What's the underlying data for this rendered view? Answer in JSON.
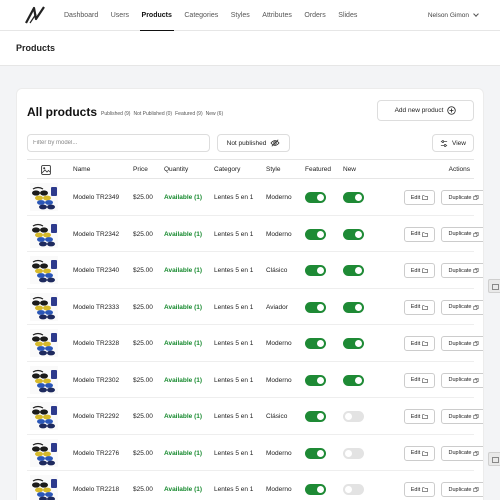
{
  "nav": {
    "items": [
      {
        "label": "Dashboard",
        "name": "nav-dashboard",
        "active": false
      },
      {
        "label": "Users",
        "name": "nav-users",
        "active": false
      },
      {
        "label": "Products",
        "name": "nav-products",
        "active": true
      },
      {
        "label": "Categories",
        "name": "nav-categories",
        "active": false
      },
      {
        "label": "Styles",
        "name": "nav-styles",
        "active": false
      },
      {
        "label": "Attributes",
        "name": "nav-attributes",
        "active": false
      },
      {
        "label": "Orders",
        "name": "nav-orders",
        "active": false
      },
      {
        "label": "Slides",
        "name": "nav-slides",
        "active": false
      }
    ],
    "user_name": "Nelson Gimon"
  },
  "page": {
    "title": "Products"
  },
  "card": {
    "title": "All products",
    "counts": [
      "Published (9)",
      "Not Published (0)",
      "Featured (9)",
      "New (6)"
    ],
    "add_label": "Add new product",
    "filter_placeholder": "Filter by model...",
    "not_published_label": "Not published",
    "view_label": "View"
  },
  "table": {
    "headers": {
      "name": "Name",
      "price": "Price",
      "quantity": "Quantity",
      "category": "Category",
      "style": "Style",
      "featured": "Featured",
      "new": "New",
      "actions": "Actions"
    },
    "edit_label": "Edit",
    "duplicate_label": "Duplicate",
    "rows": [
      {
        "name": "Modelo TR2349",
        "price": "$25.00",
        "quantity": "Available (1)",
        "category": "Lentes 5 en 1",
        "style": "Moderno",
        "featured": true,
        "new": true
      },
      {
        "name": "Modelo TR2342",
        "price": "$25.00",
        "quantity": "Available (1)",
        "category": "Lentes 5 en 1",
        "style": "Moderno",
        "featured": true,
        "new": true
      },
      {
        "name": "Modelo TR2340",
        "price": "$25.00",
        "quantity": "Available (1)",
        "category": "Lentes 5 en 1",
        "style": "Clásico",
        "featured": true,
        "new": true
      },
      {
        "name": "Modelo TR2333",
        "price": "$25.00",
        "quantity": "Available (1)",
        "category": "Lentes 5 en 1",
        "style": "Aviador",
        "featured": true,
        "new": true
      },
      {
        "name": "Modelo TR2328",
        "price": "$25.00",
        "quantity": "Available (1)",
        "category": "Lentes 5 en 1",
        "style": "Moderno",
        "featured": true,
        "new": true
      },
      {
        "name": "Modelo TR2302",
        "price": "$25.00",
        "quantity": "Available (1)",
        "category": "Lentes 5 en 1",
        "style": "Moderno",
        "featured": true,
        "new": true
      },
      {
        "name": "Modelo TR2292",
        "price": "$25.00",
        "quantity": "Available (1)",
        "category": "Lentes 5 en 1",
        "style": "Clásico",
        "featured": true,
        "new": false
      },
      {
        "name": "Modelo TR2276",
        "price": "$25.00",
        "quantity": "Available (1)",
        "category": "Lentes 5 en 1",
        "style": "Moderno",
        "featured": true,
        "new": false
      },
      {
        "name": "Modelo TR2218",
        "price": "$25.00",
        "quantity": "Available (1)",
        "category": "Lentes 5 en 1",
        "style": "Moderno",
        "featured": true,
        "new": false
      }
    ]
  },
  "colors": {
    "accent": "#1e8a35",
    "available": "#178a2f",
    "toggle_off": "#e3e3e3"
  }
}
